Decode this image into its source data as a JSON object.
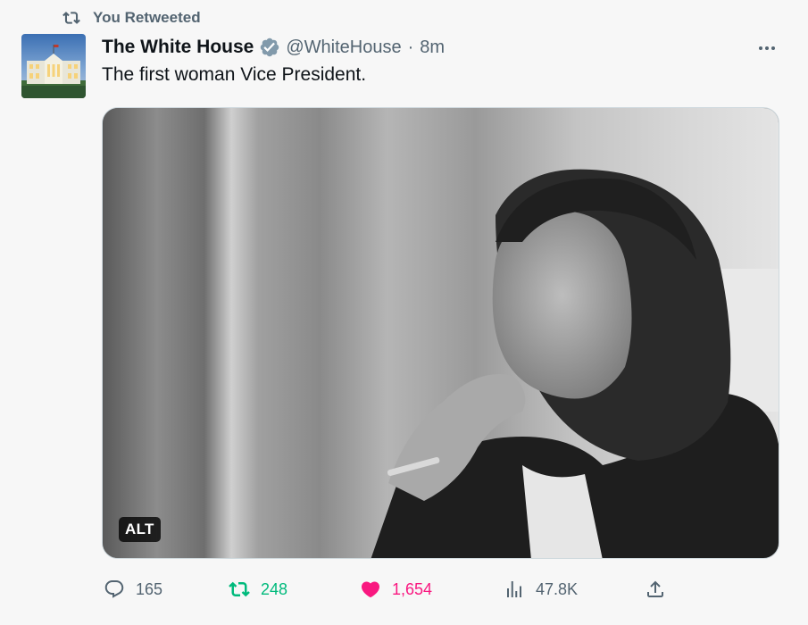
{
  "social_context": {
    "icon": "retweet-icon",
    "text": "You Retweeted"
  },
  "tweet": {
    "avatar_icon": "white-house-avatar",
    "display_name": "The White House",
    "verified_icon": "verified-badge-icon",
    "handle": "@WhiteHouse",
    "separator": "·",
    "time": "8m",
    "more_icon": "more-icon",
    "text": "The first woman Vice President.",
    "media": {
      "alt_badge": "ALT"
    },
    "actions": {
      "reply": {
        "icon": "reply-icon",
        "count": "165"
      },
      "retweet": {
        "icon": "retweet-icon",
        "count": "248",
        "color": "#00ba7c",
        "active": true
      },
      "like": {
        "icon": "heart-icon",
        "count": "1,654",
        "color": "#f91880",
        "active": true
      },
      "views": {
        "icon": "views-icon",
        "count": "47.8K"
      },
      "share": {
        "icon": "share-icon"
      }
    }
  },
  "colors": {
    "secondary_text": "#536471",
    "primary_text": "#0f1419",
    "verified": "#829aab",
    "background": "#f7f7f7"
  }
}
